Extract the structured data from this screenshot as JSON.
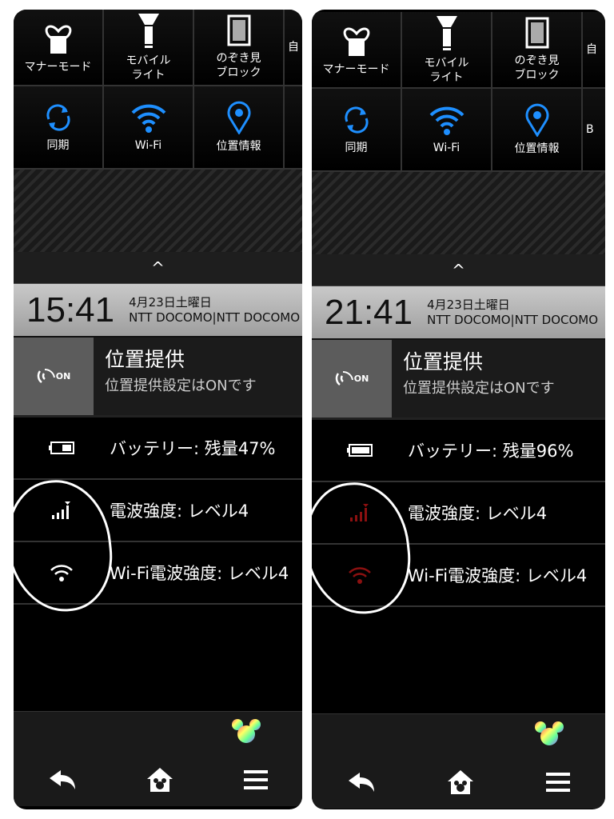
{
  "panels": [
    {
      "tiles_row1": [
        {
          "label": "マナーモード",
          "icon": "heart-phone-icon"
        },
        {
          "label": "モバイル\nライト",
          "icon": "flashlight-icon"
        },
        {
          "label": "のぞき見\nブロック",
          "icon": "privacy-filter-icon"
        },
        {
          "label": "自"
        }
      ],
      "tiles_row2": [
        {
          "label": "同期",
          "icon": "sync-icon"
        },
        {
          "label": "Wi-Fi",
          "icon": "wifi-icon"
        },
        {
          "label": "位置情報",
          "icon": "location-pin-icon"
        },
        {
          "label": ""
        }
      ],
      "caret": "^",
      "time": "15:41",
      "date": "4月23日土曜日",
      "carrier": "NTT DOCOMO|NTT DOCOMO",
      "notification": {
        "title": "位置提供",
        "subtitle": "位置提供設定はONです",
        "badge": "ON"
      },
      "battery": "バッテリー: 残量47%",
      "signal": "電波強度: レベル4",
      "wifi": "Wi-Fi電波強度: レベル4",
      "status_icon_color": "#ffffff"
    },
    {
      "tiles_row1": [
        {
          "label": "マナーモード",
          "icon": "heart-phone-icon"
        },
        {
          "label": "モバイル\nライト",
          "icon": "flashlight-icon"
        },
        {
          "label": "のぞき見\nブロック",
          "icon": "privacy-filter-icon"
        },
        {
          "label": "自"
        }
      ],
      "tiles_row2": [
        {
          "label": "同期",
          "icon": "sync-icon"
        },
        {
          "label": "Wi-Fi",
          "icon": "wifi-icon"
        },
        {
          "label": "位置情報",
          "icon": "location-pin-icon"
        },
        {
          "label": "B"
        }
      ],
      "caret": "^",
      "time": "21:41",
      "date": "4月23日土曜日",
      "carrier": "NTT DOCOMO|NTT DOCOMO",
      "notification": {
        "title": "位置提供",
        "subtitle": "位置提供設定はONです",
        "badge": "ON"
      },
      "battery": "バッテリー: 残量96%",
      "signal": "電波強度: レベル4",
      "wifi": "Wi-Fi電波強度: レベル4",
      "status_icon_color": "#8b1010"
    }
  ],
  "colors": {
    "accent": "#1e8fff",
    "background": "#000000"
  }
}
